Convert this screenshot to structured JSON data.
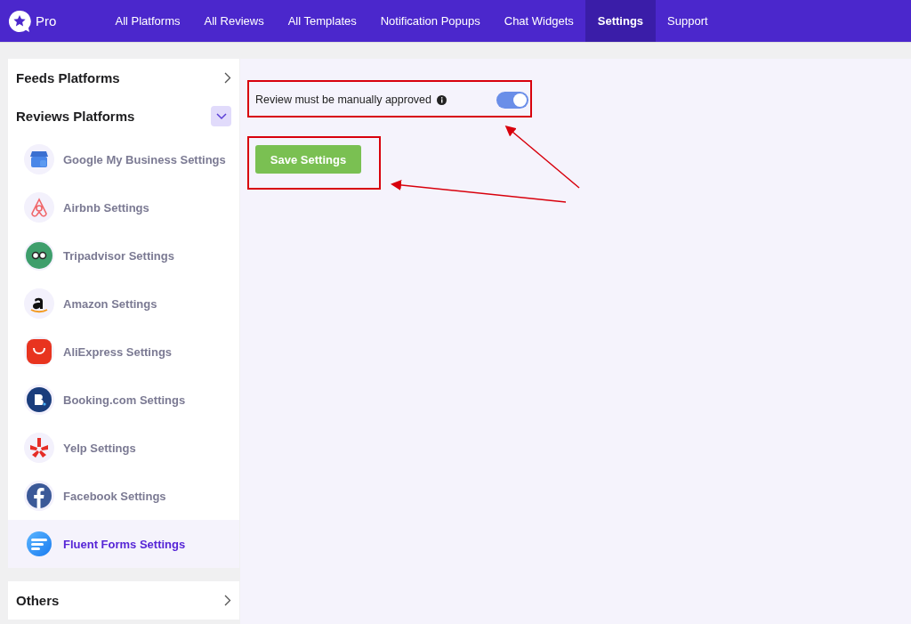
{
  "nav": {
    "brand": "Pro",
    "tabs": [
      {
        "label": "All Platforms",
        "selected": false
      },
      {
        "label": "All Reviews",
        "selected": false
      },
      {
        "label": "All Templates",
        "selected": false
      },
      {
        "label": "Notification Popups",
        "selected": false
      },
      {
        "label": "Chat Widgets",
        "selected": false
      },
      {
        "label": "Settings",
        "selected": true
      },
      {
        "label": "Support",
        "selected": false
      }
    ]
  },
  "sidebar": {
    "sections": [
      {
        "title": "Feeds Platforms",
        "expanded": false
      },
      {
        "title": "Reviews Platforms",
        "expanded": true,
        "items": [
          {
            "label": "Google My Business Settings",
            "selected": false
          },
          {
            "label": "Airbnb Settings",
            "selected": false
          },
          {
            "label": "Tripadvisor Settings",
            "selected": false
          },
          {
            "label": "Amazon Settings",
            "selected": false
          },
          {
            "label": "AliExpress Settings",
            "selected": false
          },
          {
            "label": "Booking.com Settings",
            "selected": false
          },
          {
            "label": "Yelp Settings",
            "selected": false
          },
          {
            "label": "Facebook Settings",
            "selected": false
          },
          {
            "label": "Fluent Forms Settings",
            "selected": true
          }
        ]
      },
      {
        "title": "Others",
        "expanded": false
      }
    ]
  },
  "settings": {
    "option": {
      "label": "Review must be manually approved",
      "on": true
    },
    "save_button": "Save Settings"
  }
}
